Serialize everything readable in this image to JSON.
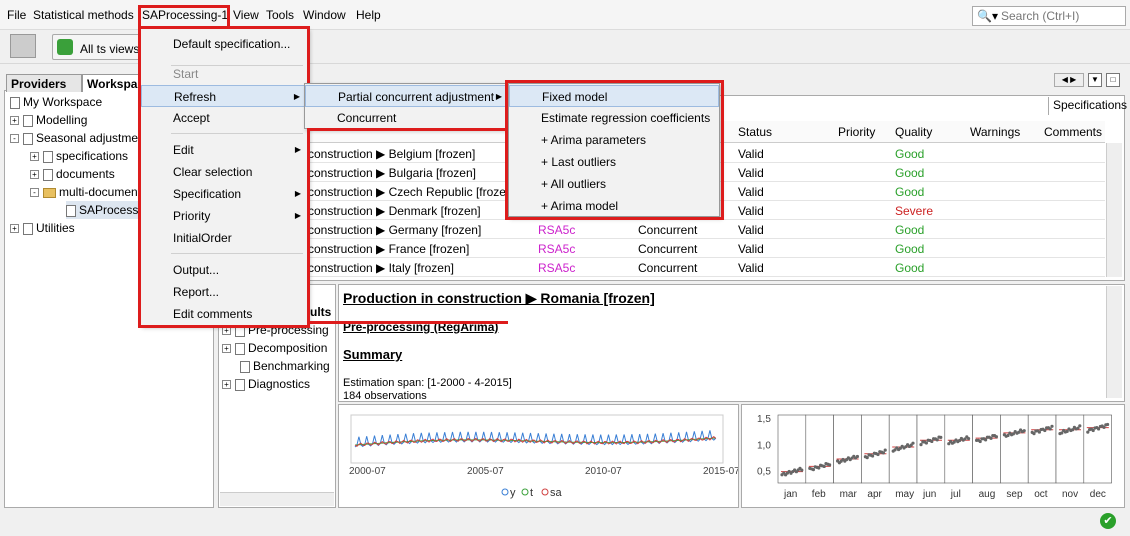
{
  "menubar": {
    "items": [
      "File",
      "Statistical methods",
      "SAProcessing-1",
      "View",
      "Tools",
      "Window",
      "Help"
    ],
    "search_placeholder": "Search (Ctrl+I)"
  },
  "toolbar": {
    "all_ts_views": "All ts views"
  },
  "left_panel": {
    "tabs": [
      "Providers",
      "Workspace"
    ],
    "tree": [
      "My Workspace",
      "Modelling",
      "Seasonal adjustment",
      "specifications",
      "documents",
      "multi-documents",
      "SAProcessing-1",
      "Utilities"
    ]
  },
  "main_menu": {
    "items": [
      "Default specification...",
      "Start",
      "Refresh",
      "Accept",
      "Edit",
      "Clear selection",
      "Specification",
      "Priority",
      "InitialOrder",
      "Output...",
      "Report...",
      "Edit comments"
    ]
  },
  "refresh_menu": {
    "items": [
      "Partial concurrent adjustment",
      "Concurrent"
    ]
  },
  "partial_menu": {
    "items": [
      "Fixed model",
      "Estimate regression coefficients",
      "+ Arima parameters",
      "+ Last outliers",
      "+ All outliers",
      "+ Arima model"
    ]
  },
  "specs_button": "Specifications",
  "table": {
    "headers": [
      "Status",
      "Priority",
      "Quality",
      "Warnings",
      "Comments"
    ],
    "rows": [
      {
        "series": "construction ▶ Belgium [frozen]",
        "method": "",
        "estimation": "",
        "status": "Valid",
        "quality": "Good"
      },
      {
        "series": "construction ▶ Bulgaria [frozen]",
        "method": "",
        "estimation": "",
        "status": "Valid",
        "quality": "Good"
      },
      {
        "series": "construction ▶ Czech Republic [frozen]",
        "method": "",
        "estimation": "",
        "status": "Valid",
        "quality": "Good"
      },
      {
        "series": "construction ▶ Denmark [frozen]",
        "method": "",
        "estimation": "",
        "status": "Valid",
        "quality": "Severe"
      },
      {
        "series": "construction ▶ Germany  [frozen]",
        "method": "RSA5c",
        "estimation": "Concurrent",
        "status": "Valid",
        "quality": "Good"
      },
      {
        "series": "construction ▶ France [frozen]",
        "method": "RSA5c",
        "estimation": "Concurrent",
        "status": "Valid",
        "quality": "Good"
      },
      {
        "series": "construction ▶ Italy [frozen]",
        "method": "RSA5c",
        "estimation": "Concurrent",
        "status": "Valid",
        "quality": "Good"
      }
    ]
  },
  "results": {
    "header": "ults",
    "tree": [
      "Pre-processing",
      "Decomposition",
      "Benchmarking",
      "Diagnostics"
    ]
  },
  "doc": {
    "title": "Production in construction ▶ Romania [frozen]",
    "subtitle": "Pre-processing (RegArima)",
    "summary": "Summary",
    "line1": "Estimation span: [1-2000 - 4-2015]",
    "line2": "184 observations"
  },
  "colors": {
    "good": "#2aa02a",
    "severe": "#cc2222",
    "rsa": "#cc22cc",
    "highlight": "#dd1c1c"
  },
  "chart_data": [
    {
      "type": "line",
      "x_ticks": [
        "2000-07",
        "2005-07",
        "2010-07",
        "2015-07"
      ],
      "series": [
        {
          "name": "y",
          "color": "#3a7fd5"
        },
        {
          "name": "t",
          "color": "#3aa03a"
        },
        {
          "name": "sa",
          "color": "#d04040"
        }
      ],
      "legend": "bottom"
    },
    {
      "type": "scatter",
      "categories": [
        "jan",
        "feb",
        "mar",
        "apr",
        "may",
        "jun",
        "jul",
        "aug",
        "sep",
        "oct",
        "nov",
        "dec"
      ],
      "y_ticks": [
        "1,5",
        "1,0",
        "0,5"
      ],
      "ylim": [
        0.3,
        1.6
      ],
      "means": [
        0.48,
        0.58,
        0.72,
        0.82,
        0.95,
        1.08,
        1.08,
        1.12,
        1.22,
        1.28,
        1.28,
        1.32
      ]
    }
  ]
}
